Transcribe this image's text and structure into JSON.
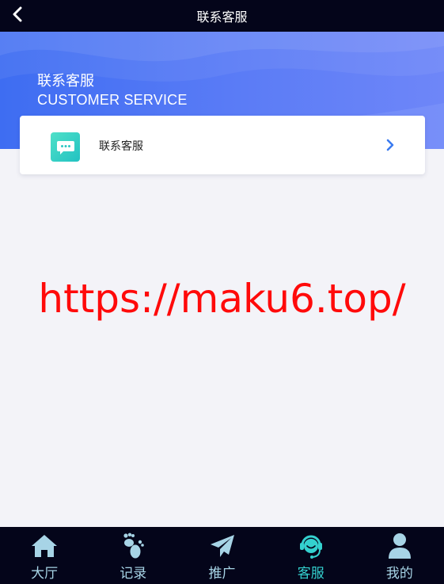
{
  "header": {
    "title": "联系客服",
    "back_icon": "chevron-left-icon"
  },
  "hero": {
    "title": "联系客服",
    "subtitle": "CUSTOMER SERVICE"
  },
  "service_card": {
    "label": "联系客服",
    "icon": "chat-bubble-icon",
    "chevron": "chevron-right-icon"
  },
  "watermark": {
    "url": "https://maku6.top/"
  },
  "tabbar": {
    "active_index": 3,
    "items": [
      {
        "label": "大厅",
        "icon": "home-icon"
      },
      {
        "label": "记录",
        "icon": "footprints-icon"
      },
      {
        "label": "推广",
        "icon": "paper-plane-icon"
      },
      {
        "label": "客服",
        "icon": "headset-agent-icon"
      },
      {
        "label": "我的",
        "icon": "user-icon"
      }
    ]
  },
  "colors": {
    "topbar_bg": "#04051a",
    "hero_blue": "#4f75f4",
    "tab_inactive": "#a7d4e6",
    "tab_active": "#34d1cf",
    "watermark": "#ff0a0a",
    "chevron": "#3b7bf0"
  }
}
